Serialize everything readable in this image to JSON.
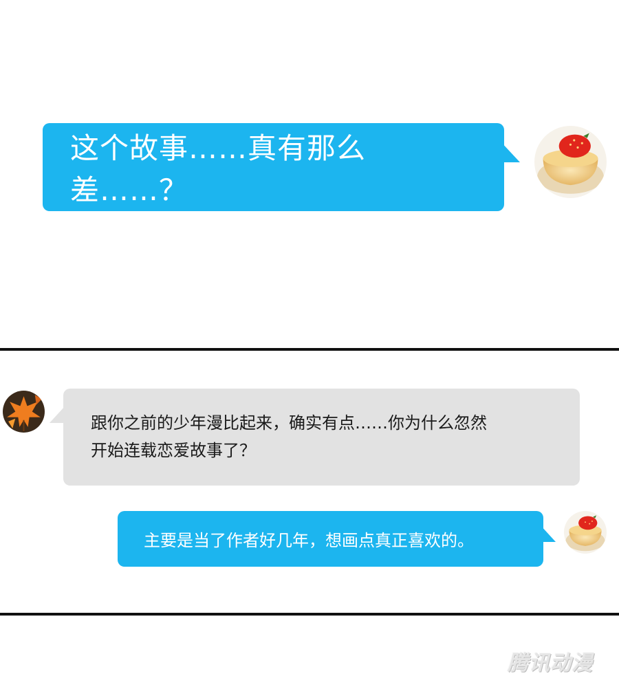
{
  "messages": [
    {
      "side": "right",
      "style": "blue",
      "text": "这个故事……真有那么差……？"
    },
    {
      "side": "left",
      "style": "grey",
      "line1": "跟你之前的少年漫比起来，确实有点……你为什么忽然",
      "line2": "开始连载恋爱故事了？"
    },
    {
      "side": "right",
      "style": "blue",
      "text": "主要是当了作者好几年，想画点真正喜欢的。"
    }
  ],
  "avatars": {
    "self": {
      "icon": "pudding-strawberry-icon",
      "description_color": "#f2c873"
    },
    "friend": {
      "icon": "maple-leaf-icon",
      "description_color": "#ef7d1f"
    }
  },
  "watermark": "腾讯动漫",
  "colors": {
    "blue_bubble": "#1cb5ef",
    "grey_bubble": "#e2e2e2",
    "divider": "#111111"
  }
}
